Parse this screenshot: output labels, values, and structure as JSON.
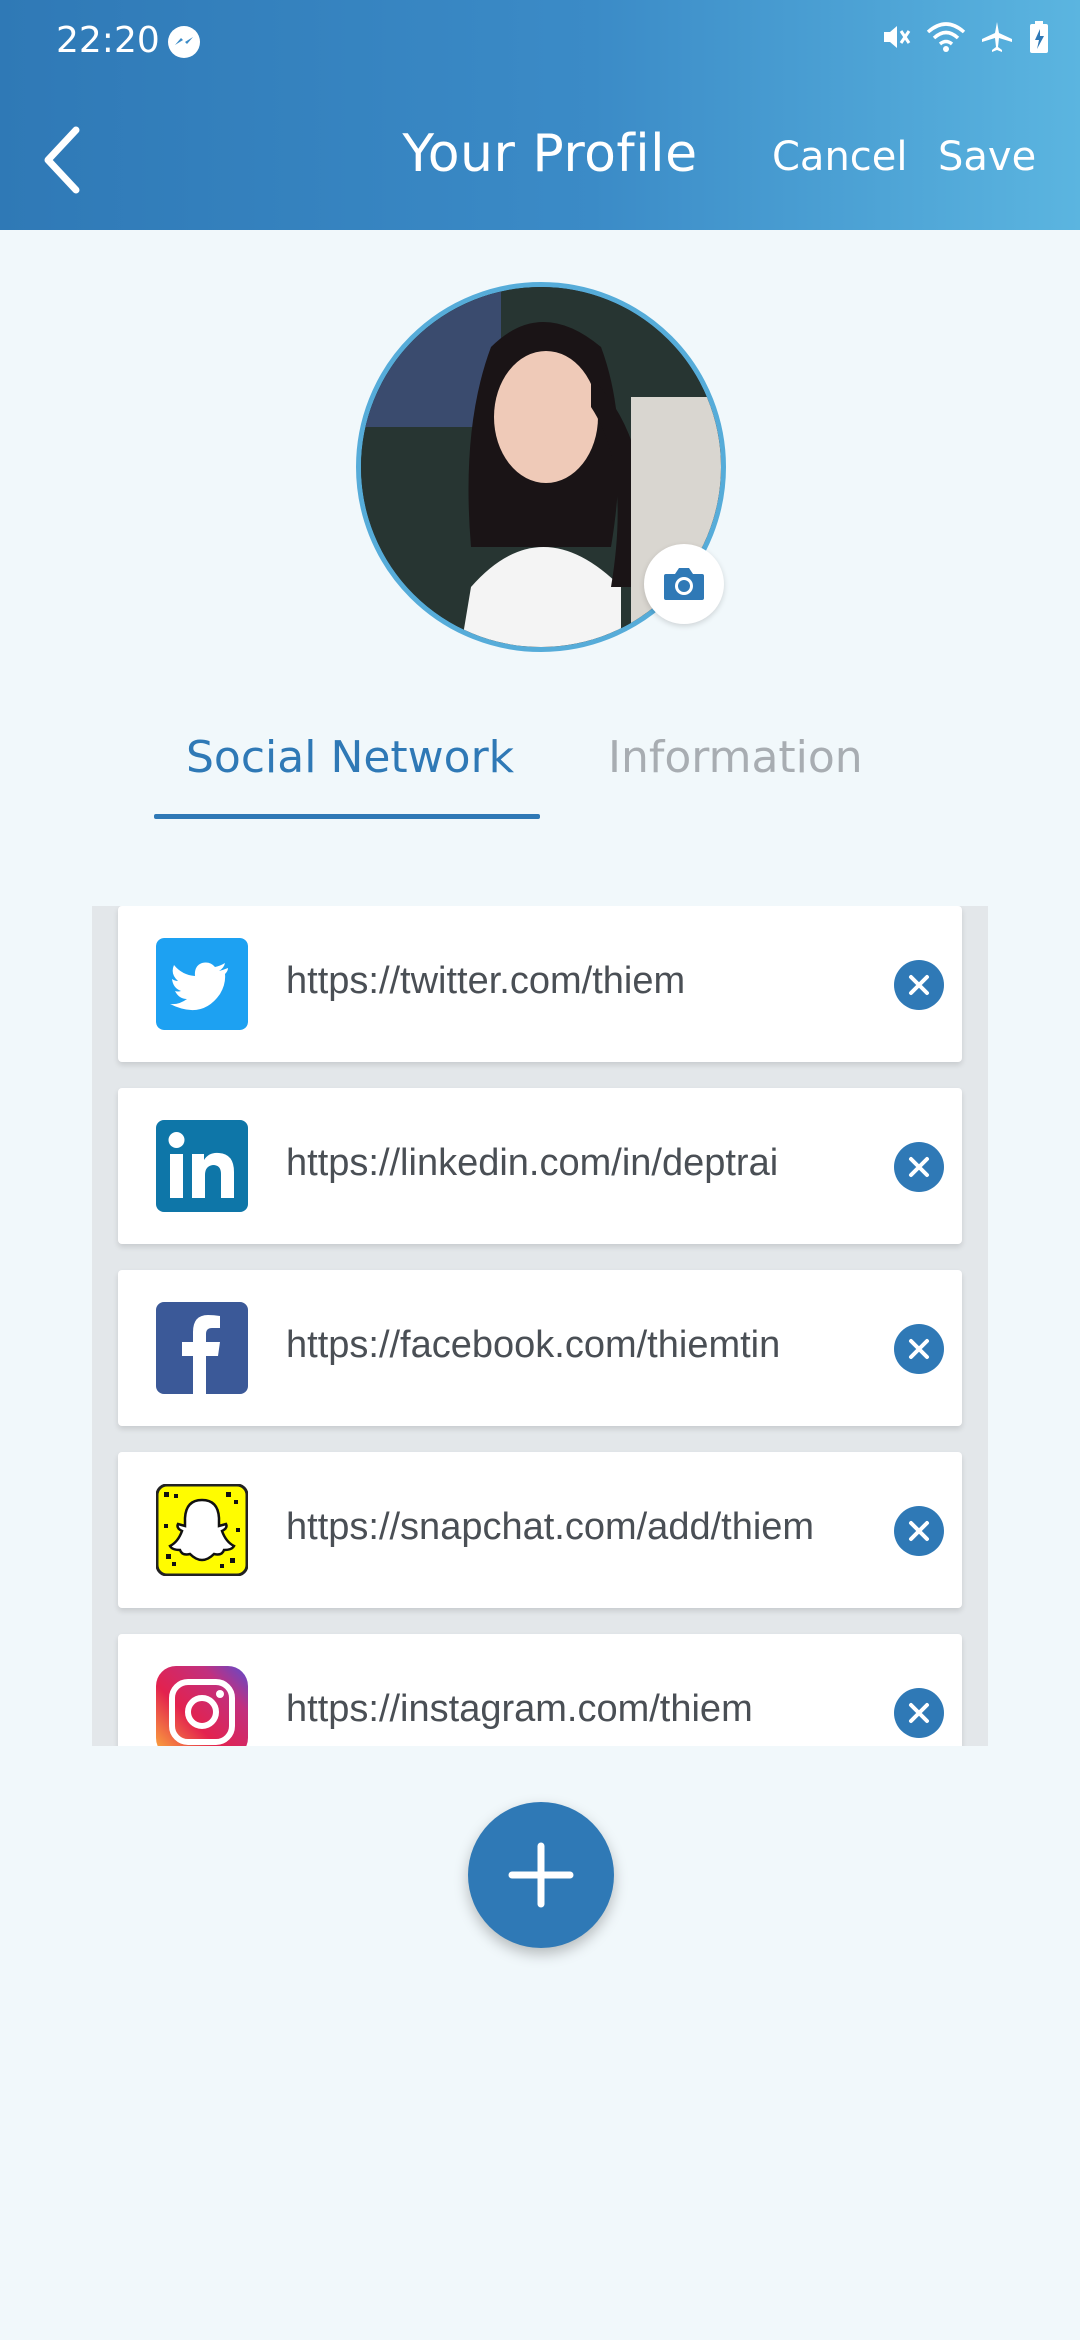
{
  "status_bar": {
    "time": "22:20",
    "icons": [
      "messenger-icon",
      "mute-icon",
      "wifi-icon",
      "airplane-icon",
      "battery-icon"
    ]
  },
  "header": {
    "title": "Your Profile",
    "cancel_label": "Cancel",
    "save_label": "Save",
    "back_icon": "chevron-left-icon"
  },
  "avatar": {
    "camera_icon": "camera-icon"
  },
  "tabs": [
    {
      "label": "Social Network",
      "active": true
    },
    {
      "label": "Information",
      "active": false
    }
  ],
  "social_links": [
    {
      "network": "twitter",
      "url": "https://twitter.com/thiem",
      "icon": "twitter-icon"
    },
    {
      "network": "linkedin",
      "url": "https://linkedin.com/in/deptrai",
      "icon": "linkedin-icon"
    },
    {
      "network": "facebook",
      "url": "https://facebook.com/thiemtin",
      "icon": "facebook-icon"
    },
    {
      "network": "snapchat",
      "url": "https://snapchat.com/add/thiem",
      "icon": "snapchat-icon"
    },
    {
      "network": "instagram",
      "url": "https://instagram.com/thiem",
      "icon": "instagram-icon"
    }
  ],
  "colors": {
    "primary": "#2f79b6",
    "header_gradient_end": "#5bb5e0",
    "background": "#f1f8fb",
    "inactive_tab": "#a8adb2"
  }
}
